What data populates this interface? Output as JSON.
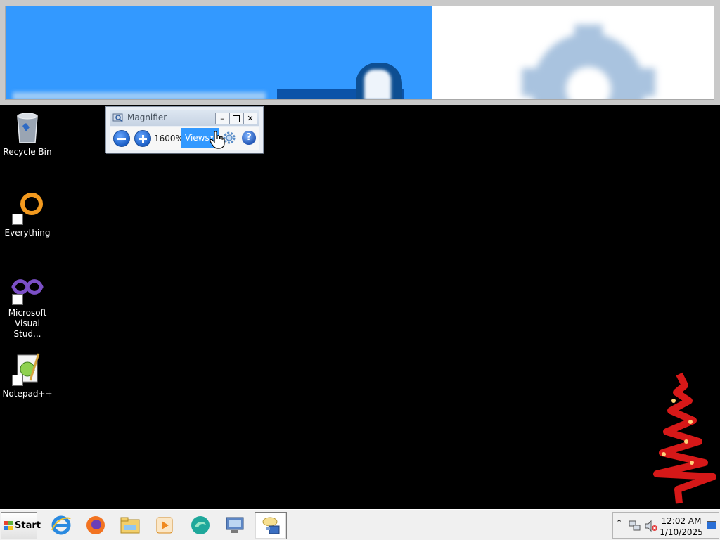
{
  "magnifier": {
    "title": "Magnifier",
    "zoom_level": "1600%",
    "views_label": "Views",
    "views_arrow": "▾",
    "help_label": "?",
    "minimize_label": "–",
    "close_label": "✕"
  },
  "desktop": {
    "icons": [
      {
        "label": "Recycle Bin"
      },
      {
        "label": "Everything"
      },
      {
        "label": "Microsoft Visual Stud..."
      },
      {
        "label": "Notepad++"
      }
    ]
  },
  "taskbar": {
    "start_label": "Start",
    "apps": [
      {
        "name": "internet-explorer-icon"
      },
      {
        "name": "firefox-icon"
      },
      {
        "name": "file-explorer-icon"
      },
      {
        "name": "media-player-icon"
      },
      {
        "name": "browser-icon"
      },
      {
        "name": "remote-desktop-icon"
      },
      {
        "name": "magnifier-icon",
        "active": true
      }
    ],
    "tray": {
      "chevron": "⌃",
      "time": "12:02 AM",
      "date": "1/10/2025"
    }
  },
  "colors": {
    "accent": "#3399ff",
    "desktop_bg": "#000000",
    "taskbar_bg": "#f0f0f0"
  }
}
